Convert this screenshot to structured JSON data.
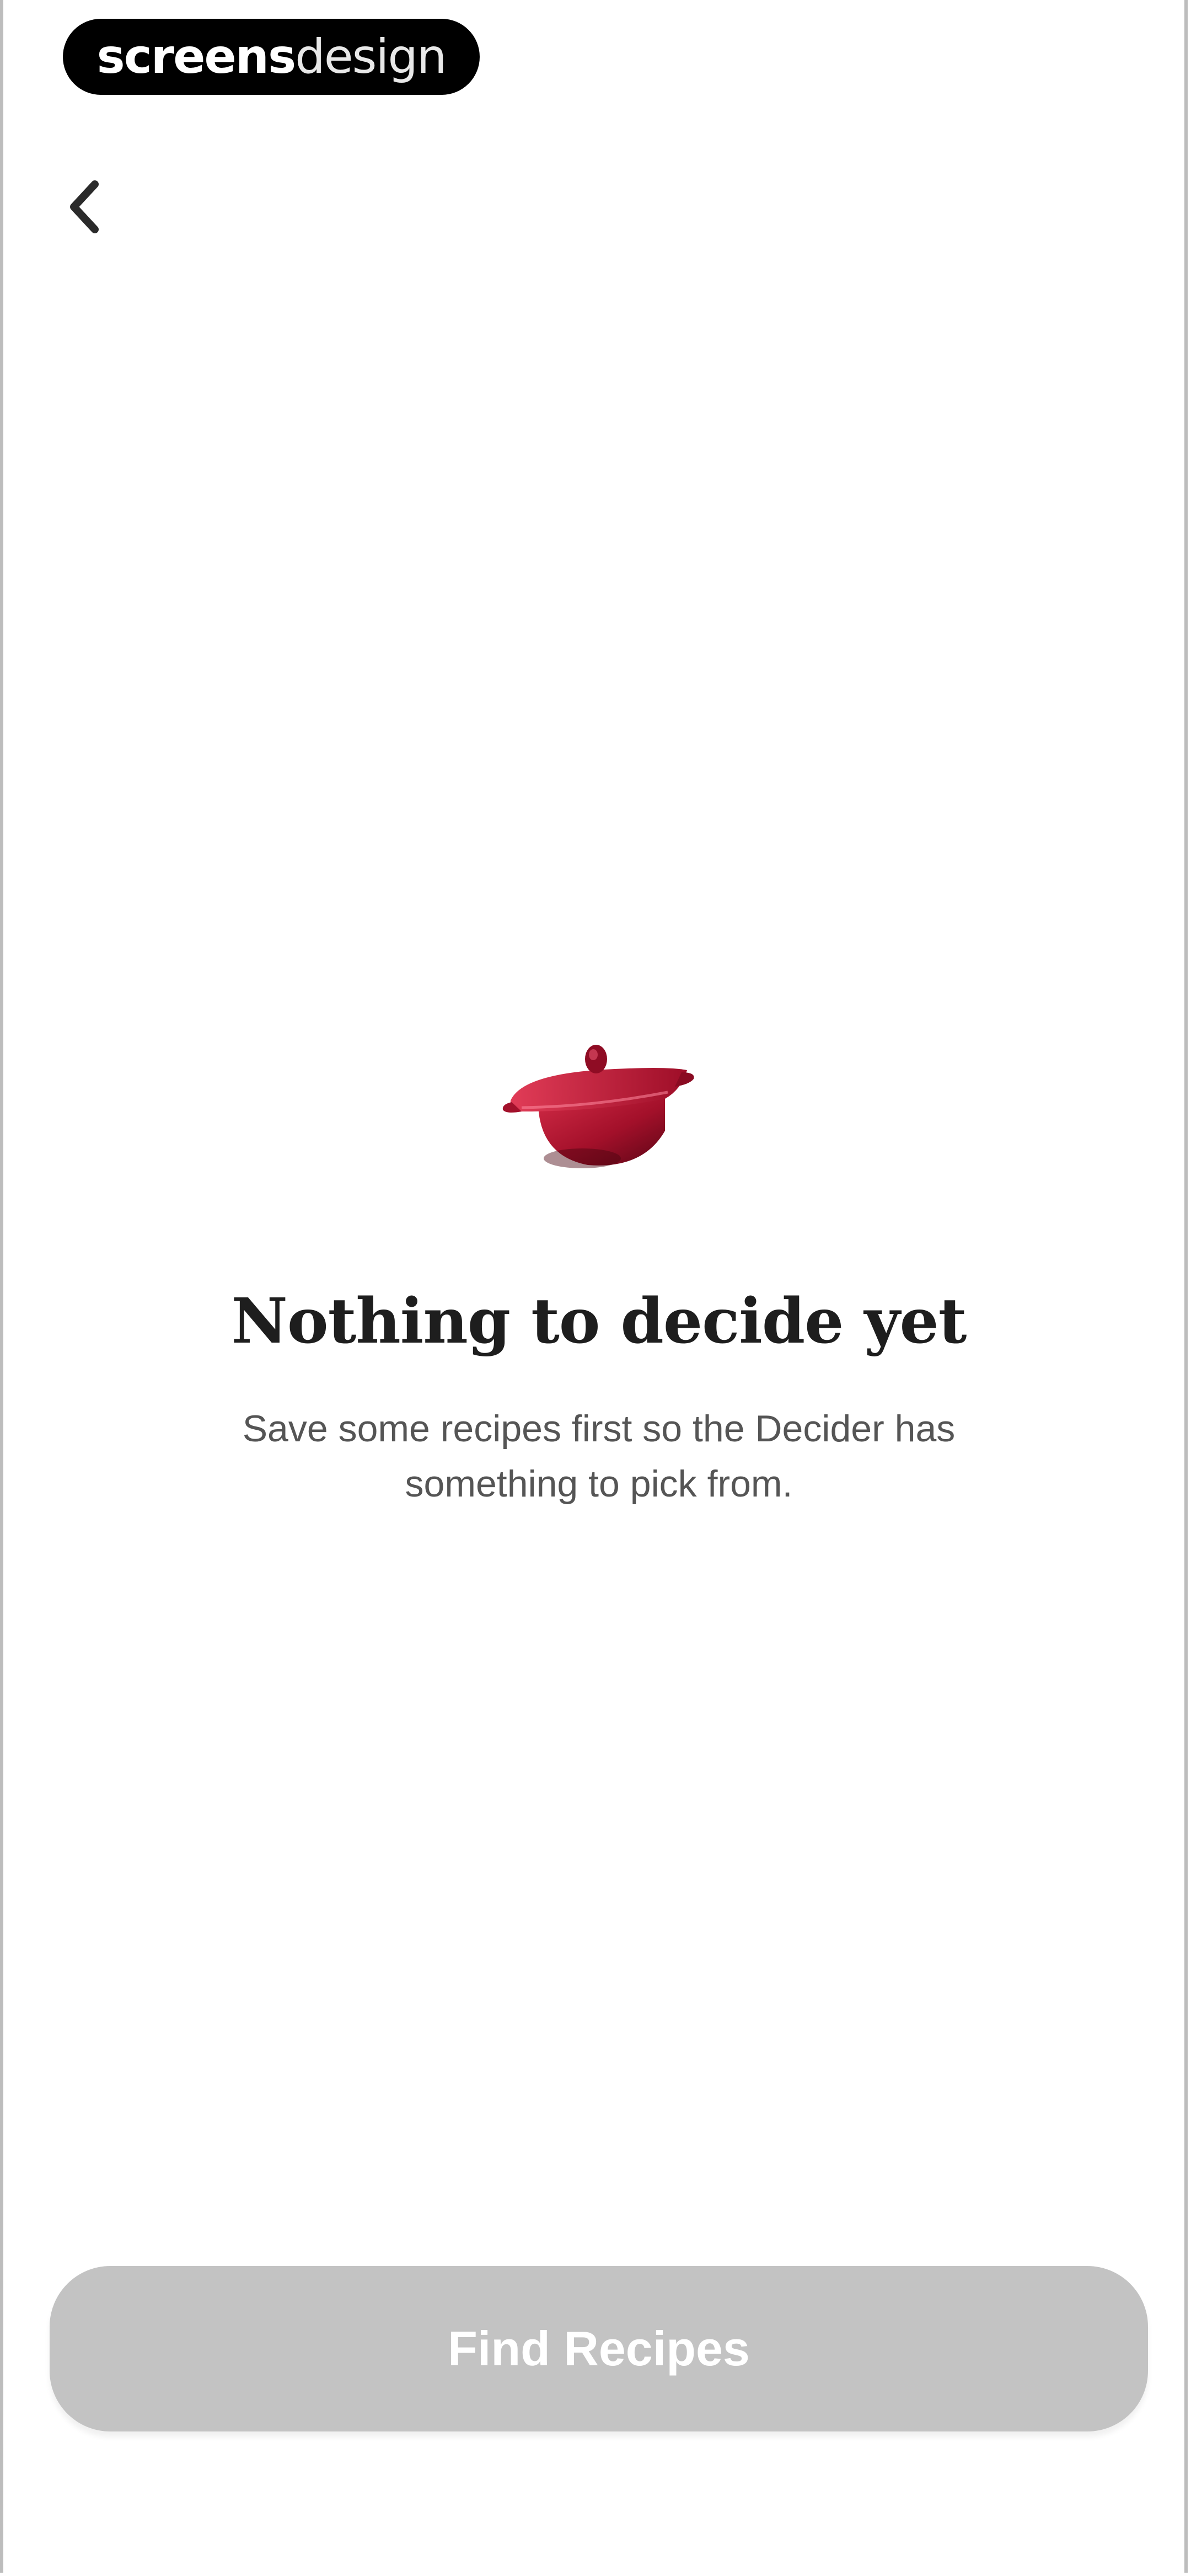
{
  "watermark": {
    "part1": "screens",
    "part2": "design"
  },
  "nav": {
    "back_icon": "chevron-left-icon"
  },
  "empty_state": {
    "illustration": "red-dutch-oven-pot",
    "title": "Nothing to decide yet",
    "subtitle": "Save some recipes first so the Decider has something to pick from."
  },
  "actions": {
    "find_recipes_label": "Find Recipes",
    "button_color": "#C3C3C3"
  },
  "colors": {
    "pot_red": "#B0132E",
    "title_text": "#1E1E1E",
    "subtitle_text": "#555555"
  }
}
